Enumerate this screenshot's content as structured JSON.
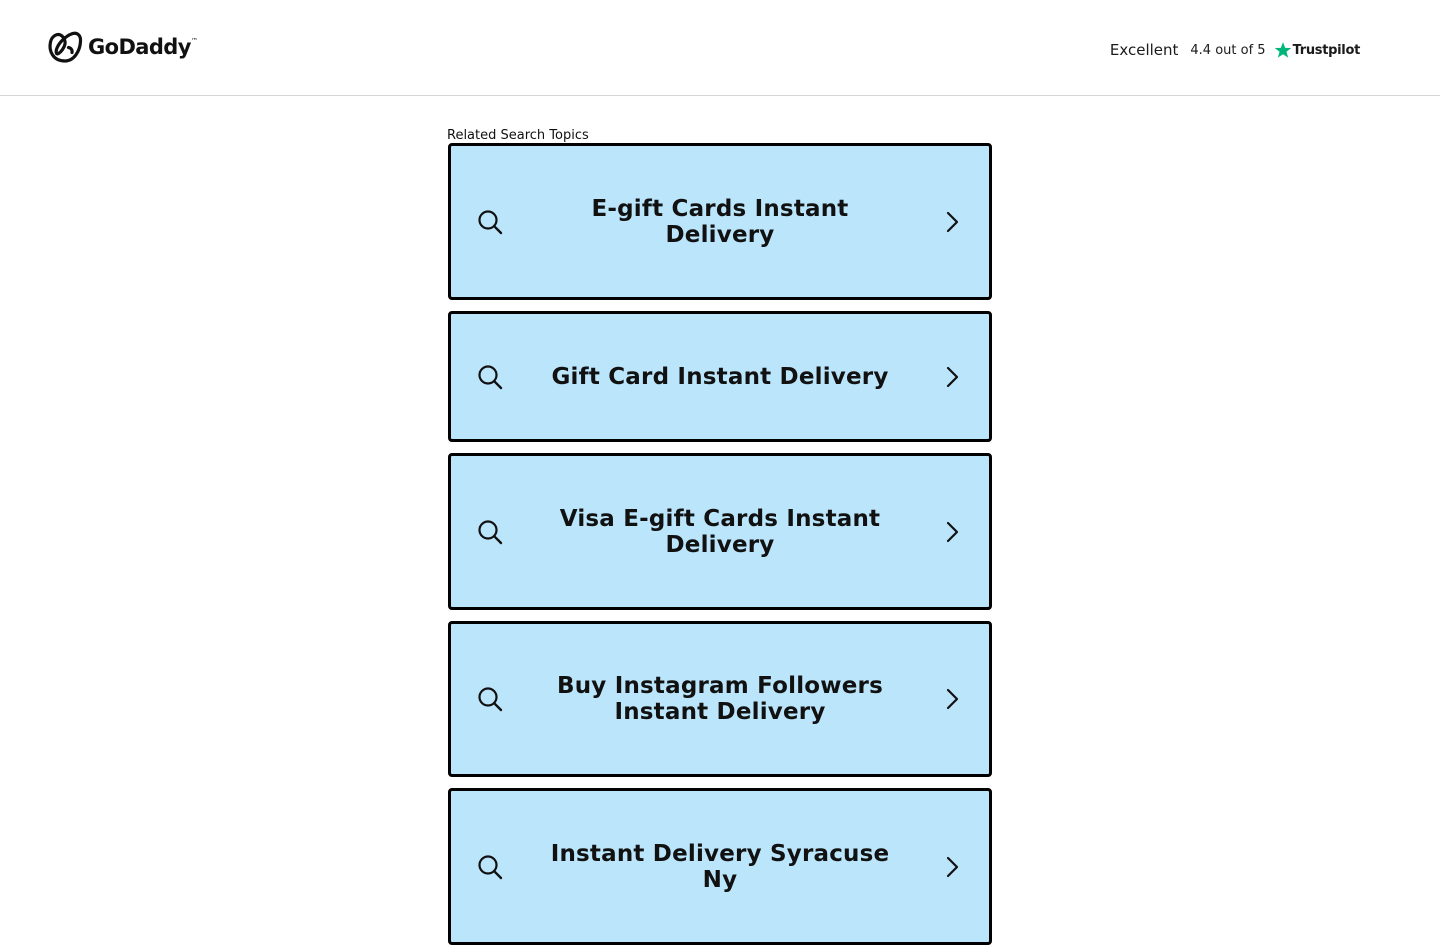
{
  "header": {
    "logo_text": "GoDaddy",
    "logo_trademark": "™",
    "trustpilot": {
      "rating_word": "Excellent",
      "score_text": "4.4 out of 5",
      "brand": "Trustpilot",
      "star_color": "#00b67a"
    }
  },
  "main": {
    "section_label": "Related Search Topics",
    "topics": [
      {
        "label": "E-gift Cards Instant Delivery"
      },
      {
        "label": "Gift Card Instant Delivery"
      },
      {
        "label": "Visa E-gift Cards Instant Delivery"
      },
      {
        "label": "Buy Instagram Followers Instant Delivery"
      },
      {
        "label": "Instant Delivery Syracuse Ny"
      }
    ]
  },
  "colors": {
    "card_background": "#bbe5fb",
    "card_border": "#000000",
    "header_divider": "#d6d6d6"
  },
  "icons": {
    "card_leading": "search-icon",
    "card_trailing": "chevron-right-icon"
  }
}
